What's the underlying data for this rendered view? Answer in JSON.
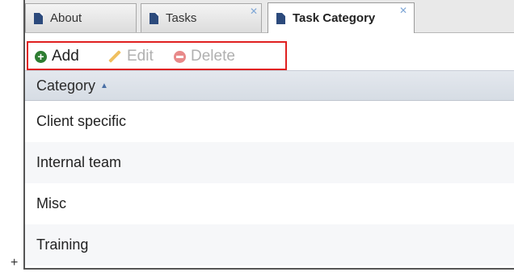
{
  "tabs": [
    {
      "label": "About",
      "closable": false,
      "active": false
    },
    {
      "label": "Tasks",
      "closable": true,
      "active": false
    },
    {
      "label": "Task Category",
      "closable": true,
      "active": true
    }
  ],
  "toolbar": {
    "add_label": "Add",
    "edit_label": "Edit",
    "delete_label": "Delete"
  },
  "grid": {
    "column_header": "Category",
    "sort": "ascending",
    "rows": [
      "Client specific",
      "Internal team",
      "Misc",
      "Training"
    ]
  },
  "side_marker": "+",
  "icons": {
    "tab": "document-icon",
    "close": "close-icon",
    "add": "plus-circle-icon",
    "edit": "pencil-icon",
    "delete": "minus-circle-icon",
    "sort": "sort-up-icon"
  },
  "colors": {
    "highlight_border": "#e02020",
    "add_icon": "#2e7d32",
    "disabled_text": "#b0b0b0"
  }
}
